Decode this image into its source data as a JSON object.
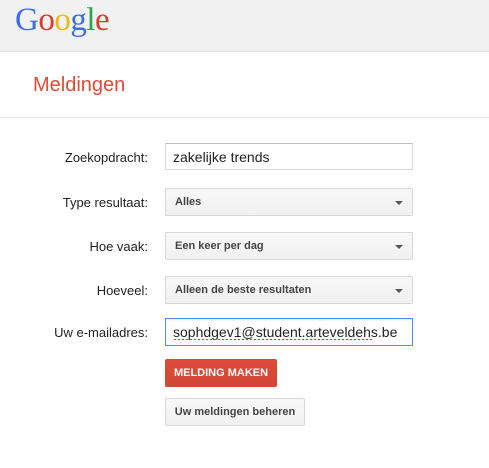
{
  "header": {
    "logo_letters": [
      {
        "char": "G",
        "color": "#3b6fe6"
      },
      {
        "char": "o",
        "color": "#dd3b2c"
      },
      {
        "char": "o",
        "color": "#f2b90b"
      },
      {
        "char": "g",
        "color": "#3b6fe6"
      },
      {
        "char": "l",
        "color": "#2aa54b"
      },
      {
        "char": "e",
        "color": "#dd3b2c"
      }
    ]
  },
  "page": {
    "title": "Meldingen"
  },
  "form": {
    "query_label": "Zoekopdracht:",
    "query_value": "zakelijke trends",
    "type_label": "Type resultaat:",
    "type_value": "Alles",
    "frequency_label": "Hoe vaak:",
    "frequency_value": "Een keer per dag",
    "amount_label": "Hoeveel:",
    "amount_value": "Alleen de beste resultaten",
    "email_label": "Uw e-mailadres:",
    "email_value": "sophdgev1@student.arteveldehs.be"
  },
  "actions": {
    "create_label": "MELDING MAKEN",
    "manage_label": "Uw meldingen beheren"
  },
  "colors": {
    "accent": "#dd4b39",
    "focus": "#4d90fe"
  }
}
